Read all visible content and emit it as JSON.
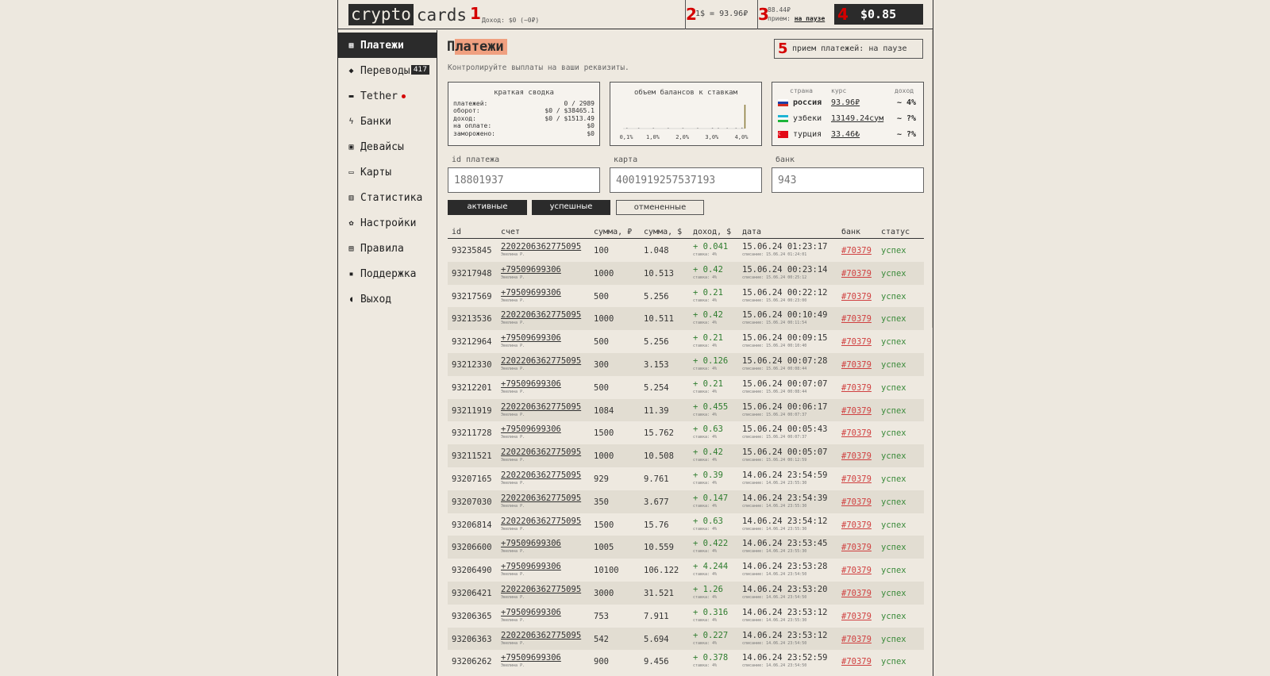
{
  "header": {
    "logo_a": "crypto",
    "logo_b": "cards",
    "income": "Доход: $0 (~0₽)",
    "rate": "1$ = 93.96₽",
    "status_value": "88.44₽",
    "status_label": "прием:",
    "status_link": "на паузе",
    "balance": "$0.85",
    "markers": [
      "1",
      "2",
      "3",
      "4",
      "5"
    ]
  },
  "sidebar": {
    "items": [
      {
        "label": "Платежи",
        "icon": "receipt-icon",
        "glyph": "▦",
        "active": true
      },
      {
        "label": "Переводы",
        "icon": "diamond-icon",
        "glyph": "◆",
        "badge": "417"
      },
      {
        "label": "Tether",
        "icon": "wallet-icon",
        "glyph": "▬",
        "dot": true
      },
      {
        "label": "Банки",
        "icon": "lightning-icon",
        "glyph": "ϟ"
      },
      {
        "label": "Девайсы",
        "icon": "chip-icon",
        "glyph": "▣"
      },
      {
        "label": "Карты",
        "icon": "card-icon",
        "glyph": "▭"
      },
      {
        "label": "Статистика",
        "icon": "bar-chart-icon",
        "glyph": "▥"
      },
      {
        "label": "Настройки",
        "icon": "gear-icon",
        "glyph": "✿"
      },
      {
        "label": "Правила",
        "icon": "document-icon",
        "glyph": "▤"
      },
      {
        "label": "Поддержка",
        "icon": "chat-icon",
        "glyph": "▪"
      },
      {
        "label": "Выход",
        "icon": "footprints-icon",
        "glyph": "◖"
      }
    ]
  },
  "main": {
    "title_first": "П",
    "title_rest": "латежи",
    "subtitle": "Контролируйте выплаты на ваши реквизиты.",
    "pause_label": "прием платежей: на паузе"
  },
  "summary": {
    "title": "краткая сводка",
    "rows": [
      {
        "k": "платежей:",
        "v": "0 / 2989"
      },
      {
        "k": "оборот:",
        "v": "$0 / $38465.1"
      },
      {
        "k": "доход:",
        "v": "$0 / $1513.49"
      },
      {
        "k": "на оплате:",
        "v": "$0"
      },
      {
        "k": "заморожено:",
        "v": "$0"
      }
    ]
  },
  "chart_data": {
    "type": "bar",
    "title": "объем балансов к ставкам",
    "categories": [
      "0,1%",
      "1,0%",
      "2,0%",
      "3,0%",
      "4,0%"
    ],
    "ticks": [
      "0,1%",
      "1,0%",
      "2,0%",
      "3,0%",
      "4,0%"
    ],
    "x": [
      0.1,
      0.5,
      1.0,
      1.5,
      2.0,
      2.5,
      3.0,
      3.2,
      3.5,
      3.8,
      4.0,
      4.1
    ],
    "values": [
      1,
      1,
      1,
      1,
      2,
      1,
      3,
      2,
      1,
      2,
      4,
      100
    ]
  },
  "rates": {
    "head": {
      "country": "страна",
      "rate": "курс",
      "income": "доход"
    },
    "rows": [
      {
        "country": "россия",
        "rate": "93.96₽",
        "income": "~ 4%",
        "bold": true
      },
      {
        "country": "узбеки",
        "rate": "13149.24сум",
        "income": "~ ?%"
      },
      {
        "country": "турция",
        "rate": "33.46₺",
        "income": "~ ?%"
      }
    ]
  },
  "filters": {
    "id": {
      "label": "id платежа",
      "placeholder": "18801937"
    },
    "card": {
      "label": "карта",
      "placeholder": "4001919257537193"
    },
    "bank": {
      "label": "банк",
      "placeholder": "943"
    }
  },
  "tabs": {
    "active": "активные",
    "success": "успешные",
    "canceled": "отмененные"
  },
  "table": {
    "headers": {
      "id": "id",
      "acc": "счет",
      "rub": "сумма, ₽",
      "usd": "сумма, $",
      "inc": "доход, $",
      "date": "дата",
      "bank": "банк",
      "status": "статус"
    },
    "rows": [
      {
        "id": "93235845",
        "acc": "2202206362775095",
        "rub": "100",
        "usd": "1.048",
        "inc": "+ 0.041",
        "date": "15.06.24 01:23:17",
        "ds": "списание: 15.06.24 01:24:01",
        "bank": "#70379",
        "st": "успех"
      },
      {
        "id": "93217948",
        "acc": "+79509699306",
        "rub": "1000",
        "usd": "10.513",
        "inc": "+ 0.42",
        "date": "15.06.24 00:23:14",
        "ds": "списание: 15.06.24 00:25:12",
        "bank": "#70379",
        "st": "успех"
      },
      {
        "id": "93217569",
        "acc": "+79509699306",
        "rub": "500",
        "usd": "5.256",
        "inc": "+ 0.21",
        "date": "15.06.24 00:22:12",
        "ds": "списание: 15.06.24 00:23:00",
        "bank": "#70379",
        "st": "успех"
      },
      {
        "id": "93213536",
        "acc": "2202206362775095",
        "rub": "1000",
        "usd": "10.511",
        "inc": "+ 0.42",
        "date": "15.06.24 00:10:49",
        "ds": "списание: 15.06.24 00:11:54",
        "bank": "#70379",
        "st": "успех"
      },
      {
        "id": "93212964",
        "acc": "+79509699306",
        "rub": "500",
        "usd": "5.256",
        "inc": "+ 0.21",
        "date": "15.06.24 00:09:15",
        "ds": "списание: 15.06.24 00:10:40",
        "bank": "#70379",
        "st": "успех"
      },
      {
        "id": "93212330",
        "acc": "2202206362775095",
        "rub": "300",
        "usd": "3.153",
        "inc": "+ 0.126",
        "date": "15.06.24 00:07:28",
        "ds": "списание: 15.06.24 00:08:44",
        "bank": "#70379",
        "st": "успех"
      },
      {
        "id": "93212201",
        "acc": "+79509699306",
        "rub": "500",
        "usd": "5.254",
        "inc": "+ 0.21",
        "date": "15.06.24 00:07:07",
        "ds": "списание: 15.06.24 00:08:44",
        "bank": "#70379",
        "st": "успех"
      },
      {
        "id": "93211919",
        "acc": "2202206362775095",
        "rub": "1084",
        "usd": "11.39",
        "inc": "+ 0.455",
        "date": "15.06.24 00:06:17",
        "ds": "списание: 15.06.24 00:07:37",
        "bank": "#70379",
        "st": "успех"
      },
      {
        "id": "93211728",
        "acc": "+79509699306",
        "rub": "1500",
        "usd": "15.762",
        "inc": "+ 0.63",
        "date": "15.06.24 00:05:43",
        "ds": "списание: 15.06.24 00:07:37",
        "bank": "#70379",
        "st": "успех"
      },
      {
        "id": "93211521",
        "acc": "2202206362775095",
        "rub": "1000",
        "usd": "10.508",
        "inc": "+ 0.42",
        "date": "15.06.24 00:05:07",
        "ds": "списание: 15.06.24 00:12:59",
        "bank": "#70379",
        "st": "успех"
      },
      {
        "id": "93207165",
        "acc": "2202206362775095",
        "rub": "929",
        "usd": "9.761",
        "inc": "+ 0.39",
        "date": "14.06.24 23:54:59",
        "ds": "списание: 14.06.24 23:55:30",
        "bank": "#70379",
        "st": "успех"
      },
      {
        "id": "93207030",
        "acc": "2202206362775095",
        "rub": "350",
        "usd": "3.677",
        "inc": "+ 0.147",
        "date": "14.06.24 23:54:39",
        "ds": "списание: 14.06.24 23:55:30",
        "bank": "#70379",
        "st": "успех"
      },
      {
        "id": "93206814",
        "acc": "2202206362775095",
        "rub": "1500",
        "usd": "15.76",
        "inc": "+ 0.63",
        "date": "14.06.24 23:54:12",
        "ds": "списание: 14.06.24 23:55:30",
        "bank": "#70379",
        "st": "успех"
      },
      {
        "id": "93206600",
        "acc": "+79509699306",
        "rub": "1005",
        "usd": "10.559",
        "inc": "+ 0.422",
        "date": "14.06.24 23:53:45",
        "ds": "списание: 14.06.24 23:55:30",
        "bank": "#70379",
        "st": "успех"
      },
      {
        "id": "93206490",
        "acc": "+79509699306",
        "rub": "10100",
        "usd": "106.122",
        "inc": "+ 4.244",
        "date": "14.06.24 23:53:28",
        "ds": "списание: 14.06.24 23:54:50",
        "bank": "#70379",
        "st": "успех"
      },
      {
        "id": "93206421",
        "acc": "2202206362775095",
        "rub": "3000",
        "usd": "31.521",
        "inc": "+ 1.26",
        "date": "14.06.24 23:53:20",
        "ds": "списание: 14.06.24 23:54:50",
        "bank": "#70379",
        "st": "успех"
      },
      {
        "id": "93206365",
        "acc": "+79509699306",
        "rub": "753",
        "usd": "7.911",
        "inc": "+ 0.316",
        "date": "14.06.24 23:53:12",
        "ds": "списание: 14.06.24 23:55:30",
        "bank": "#70379",
        "st": "успех"
      },
      {
        "id": "93206363",
        "acc": "2202206362775095",
        "rub": "542",
        "usd": "5.694",
        "inc": "+ 0.227",
        "date": "14.06.24 23:53:12",
        "ds": "списание: 14.06.24 23:54:50",
        "bank": "#70379",
        "st": "успех"
      },
      {
        "id": "93206262",
        "acc": "+79509699306",
        "rub": "900",
        "usd": "9.456",
        "inc": "+ 0.378",
        "date": "14.06.24 23:52:59",
        "ds": "списание: 14.06.24 23:54:50",
        "bank": "#70379",
        "st": "успех"
      }
    ]
  },
  "row_sub": {
    "acc": "Эвелина Р.",
    "inc": "ставка: 4%"
  }
}
